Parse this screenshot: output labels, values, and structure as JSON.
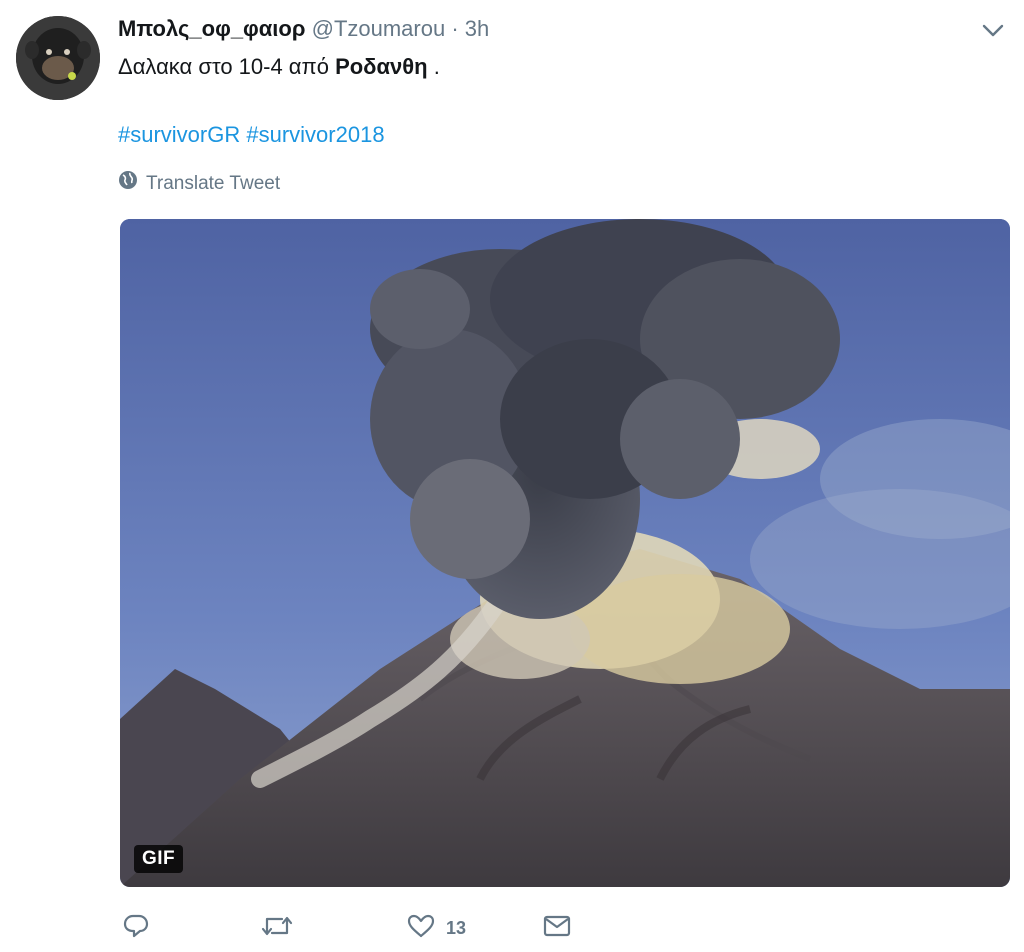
{
  "tweet": {
    "display_name": "Μπολς_οφ_φαιορ",
    "handle": "@Tzoumarou",
    "separator": "·",
    "timestamp": "3h",
    "text_before": "Δαλακα στο 10-4 από ",
    "mention": "Ροδανθη",
    "text_after": " .",
    "hashtags": [
      "#survivorGR",
      "#survivor2018"
    ],
    "translate_label": "Translate Tweet",
    "media_badge": "GIF",
    "actions": {
      "reply_icon": "reply-icon",
      "retweet_icon": "retweet-icon",
      "like_icon": "heart-icon",
      "like_count": "13",
      "dm_icon": "envelope-icon"
    }
  },
  "colors": {
    "link": "#1b95e0",
    "muted": "#657786",
    "text": "#14171a",
    "sky": "#5d70a7"
  }
}
